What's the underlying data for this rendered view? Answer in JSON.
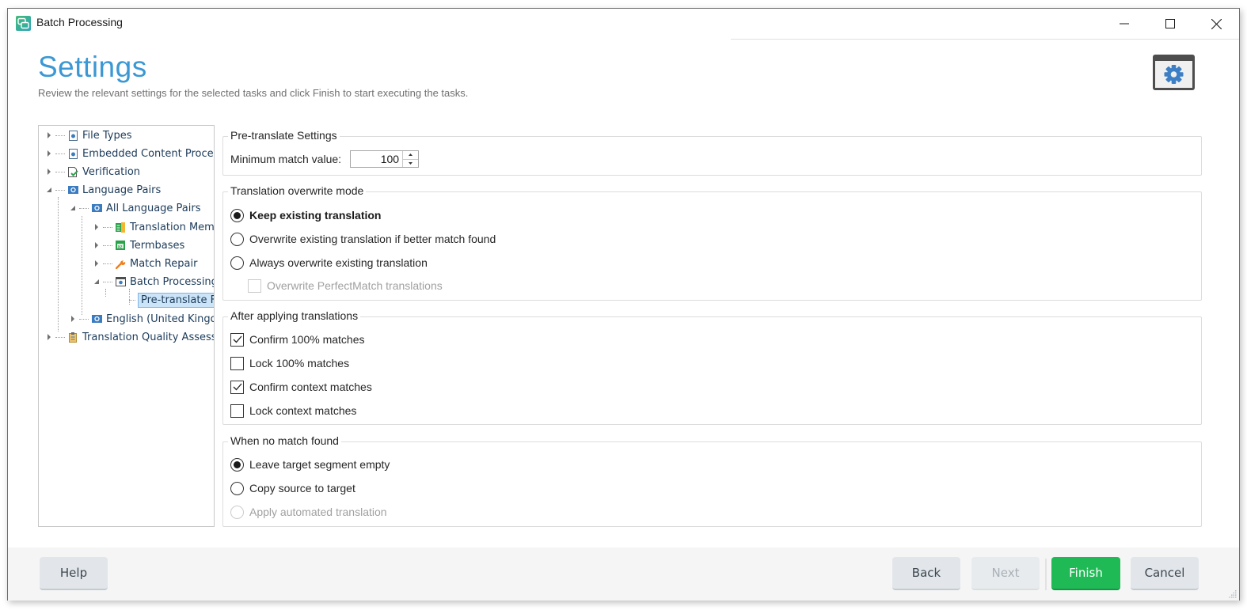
{
  "window": {
    "title": "Batch Processing",
    "controls": [
      "minimize",
      "maximize",
      "close"
    ]
  },
  "header": {
    "title": "Settings",
    "subtitle": "Review the relevant settings for the selected tasks and click Finish to start executing the tasks.",
    "badge_icon": "settings-gear-icon",
    "accent_color": "#3b98d4"
  },
  "tree": {
    "items": [
      {
        "label": "File Types",
        "level": 0,
        "expanded": false,
        "icon": "file-settings-icon"
      },
      {
        "label": "Embedded Content Proces",
        "level": 0,
        "expanded": false,
        "icon": "file-settings-icon"
      },
      {
        "label": "Verification",
        "level": 0,
        "expanded": false,
        "icon": "verification-icon"
      },
      {
        "label": "Language Pairs",
        "level": 0,
        "expanded": true,
        "icon": "language-pair-icon"
      },
      {
        "label": "All Language Pairs",
        "level": 1,
        "expanded": true,
        "icon": "language-pair-icon"
      },
      {
        "label": "Translation Mem",
        "level": 2,
        "expanded": false,
        "icon": "translation-memory-icon"
      },
      {
        "label": "Termbases",
        "level": 2,
        "expanded": false,
        "icon": "termbase-icon"
      },
      {
        "label": "Match Repair",
        "level": 2,
        "expanded": false,
        "icon": "wrench-icon"
      },
      {
        "label": "Batch Processing",
        "level": 2,
        "expanded": true,
        "icon": "batch-processing-icon"
      },
      {
        "label": "Pre-translate Fi",
        "level": 3,
        "selected": true
      },
      {
        "label": "English (United Kingd",
        "level": 1,
        "expanded": false,
        "icon": "language-pair-icon"
      },
      {
        "label": "Translation Quality Assess",
        "level": 0,
        "expanded": false,
        "icon": "clipboard-icon"
      }
    ]
  },
  "pretranslate": {
    "legend": "Pre-translate Settings",
    "min_match_label": "Minimum match value:",
    "min_match_value": "100"
  },
  "overwrite_mode": {
    "legend": "Translation overwrite mode",
    "options": [
      {
        "label": "Keep existing translation",
        "selected": true
      },
      {
        "label": "Overwrite existing translation if better match found",
        "selected": false
      },
      {
        "label": "Always overwrite existing translation",
        "selected": false
      }
    ],
    "perfectmatch": {
      "label": "Overwrite PerfectMatch translations",
      "checked": false,
      "disabled": true
    }
  },
  "after_applying": {
    "legend": "After applying translations",
    "options": [
      {
        "label": "Confirm 100% matches",
        "checked": true
      },
      {
        "label": "Lock 100% matches",
        "checked": false
      },
      {
        "label": "Confirm context matches",
        "checked": true
      },
      {
        "label": "Lock context matches",
        "checked": false
      }
    ]
  },
  "no_match": {
    "legend": "When no match found",
    "options": [
      {
        "label": "Leave target segment empty",
        "selected": true
      },
      {
        "label": "Copy source to target",
        "selected": false
      },
      {
        "label": "Apply automated translation",
        "selected": false,
        "disabled": true
      }
    ]
  },
  "footer": {
    "help": "Help",
    "back": "Back",
    "next": "Next",
    "finish": "Finish",
    "cancel": "Cancel",
    "finish_color": "#1fba55"
  }
}
